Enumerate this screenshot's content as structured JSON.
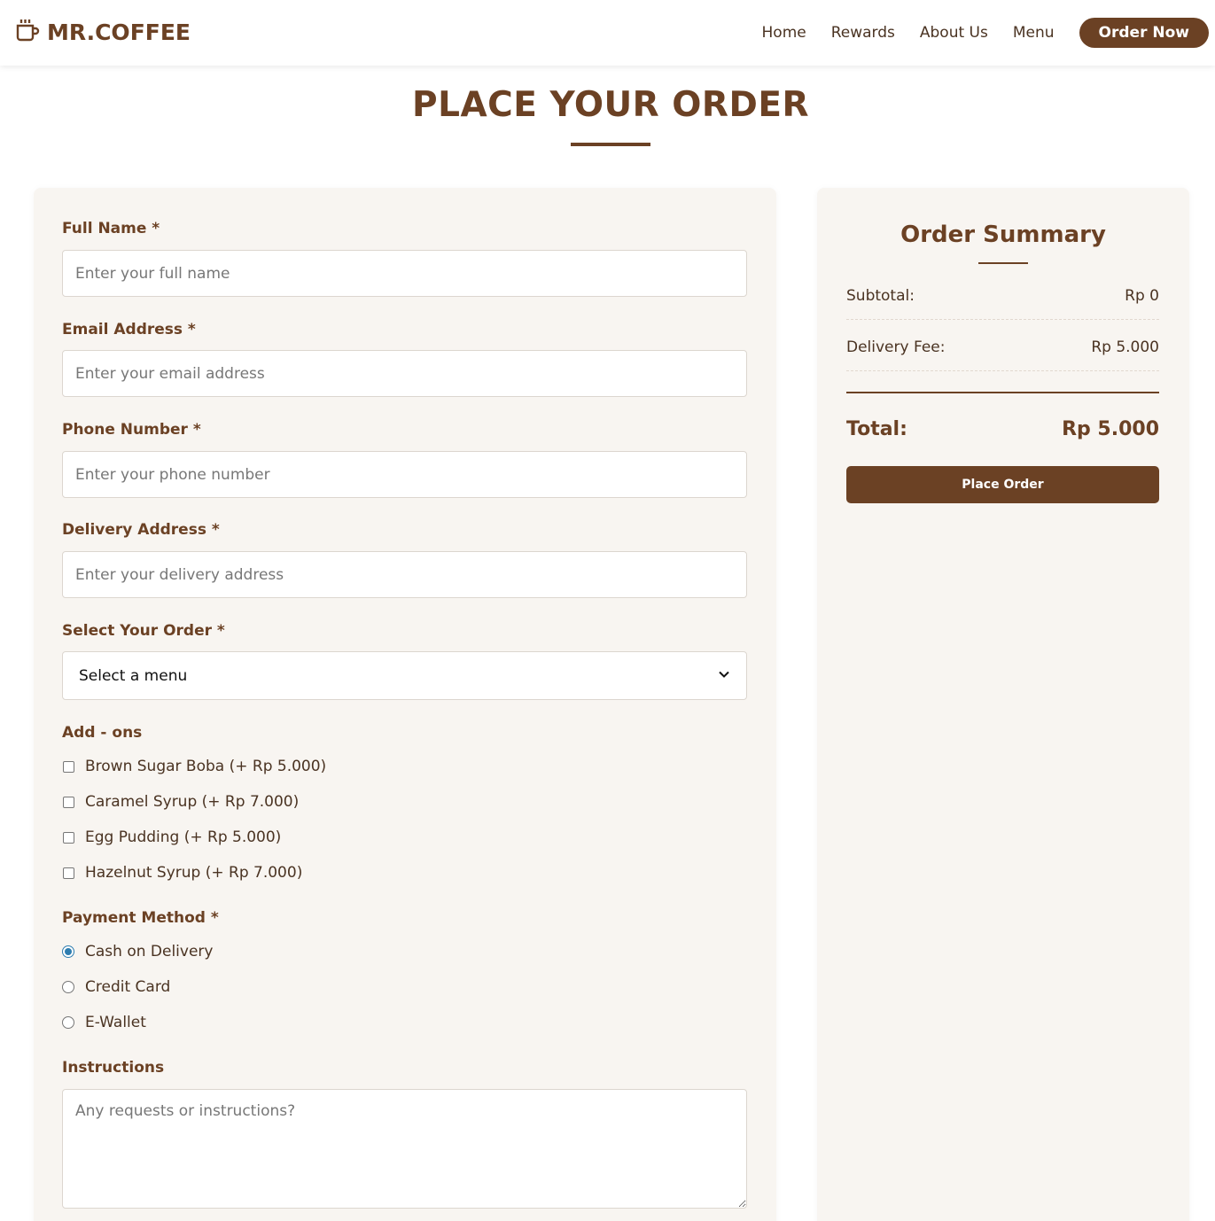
{
  "nav": {
    "brand": "MR.COFFEE",
    "brand_icon": "coffee-cup-icon",
    "links": [
      "Home",
      "Rewards",
      "About Us",
      "Menu"
    ],
    "cta": "Order Now"
  },
  "page": {
    "title": "PLACE YOUR ORDER"
  },
  "form": {
    "full_name": {
      "label": "Full Name *",
      "placeholder": "Enter your full name"
    },
    "email": {
      "label": "Email Address *",
      "placeholder": "Enter your email address"
    },
    "phone": {
      "label": "Phone Number *",
      "placeholder": "Enter your phone number"
    },
    "address": {
      "label": "Delivery Address *",
      "placeholder": "Enter your delivery address"
    },
    "order": {
      "label": "Select Your Order *",
      "selected": "Select a menu"
    },
    "addons": {
      "label": "Add - ons",
      "items": [
        "Brown Sugar Boba (+ Rp 5.000)",
        "Caramel Syrup (+ Rp 7.000)",
        "Egg Pudding (+ Rp 5.000)",
        "Hazelnut Syrup (+ Rp 7.000)"
      ]
    },
    "payment": {
      "label": "Payment Method *",
      "options": [
        "Cash on Delivery",
        "Credit Card",
        "E-Wallet"
      ],
      "selected_index": 0
    },
    "instructions": {
      "label": "Instructions",
      "placeholder": "Any requests or instructions?"
    }
  },
  "summary": {
    "title": "Order Summary",
    "subtotal_label": "Subtotal:",
    "subtotal_value": "Rp 0",
    "delivery_label": "Delivery Fee:",
    "delivery_value": "Rp 5.000",
    "total_label": "Total:",
    "total_value": "Rp 5.000",
    "button": "Place Order"
  },
  "colors": {
    "brand": "#6b4124",
    "card_bg": "#f8f5f1",
    "radio_accent": "#2e7db0"
  }
}
